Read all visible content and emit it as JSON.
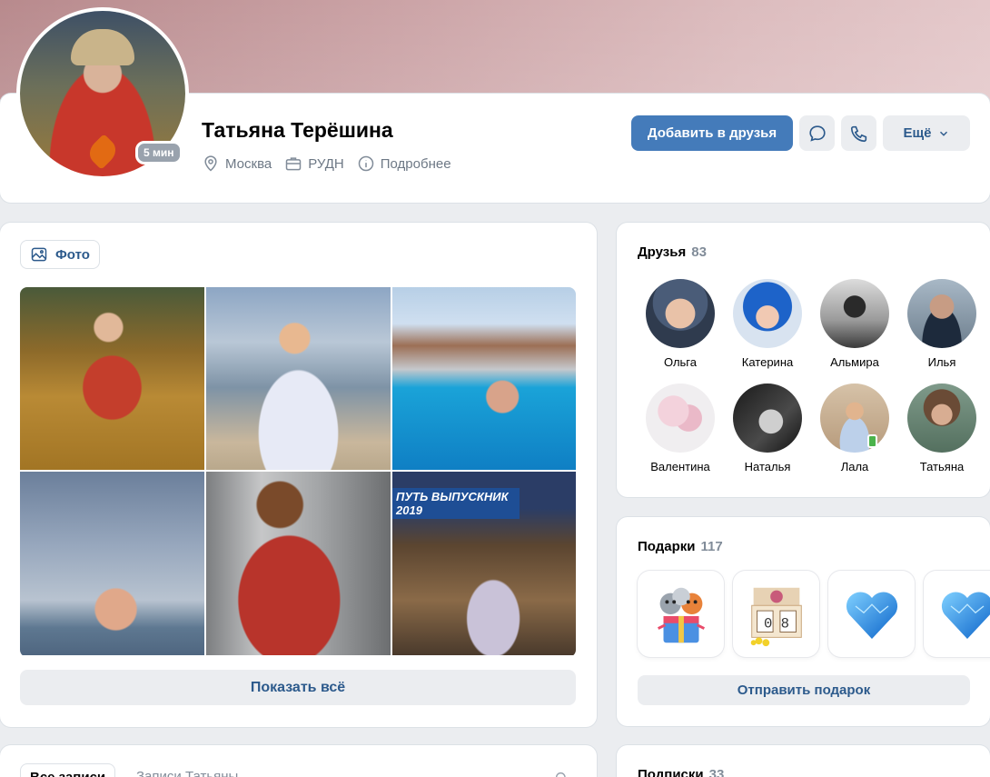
{
  "profile": {
    "name": "Татьяна Терёшина",
    "online": "5 мин",
    "city": "Москва",
    "work": "РУДН",
    "more": "Подробнее"
  },
  "actions": {
    "add_friend": "Добавить в друзья",
    "more": "Ещё"
  },
  "photos": {
    "chip_label": "Фото",
    "banner_text": "ПУТЬ ВЫПУСКНИК 2019",
    "show_all": "Показать всё"
  },
  "friends": {
    "title": "Друзья",
    "count": "83",
    "items": [
      {
        "name": "Ольга"
      },
      {
        "name": "Катерина"
      },
      {
        "name": "Альмира"
      },
      {
        "name": "Илья"
      },
      {
        "name": "Валентина"
      },
      {
        "name": "Наталья"
      },
      {
        "name": "Лала"
      },
      {
        "name": "Татьяна"
      }
    ]
  },
  "gifts": {
    "title": "Подарки",
    "count": "117",
    "calendar_digits": "0 8",
    "send": "Отправить подарок"
  },
  "posts": {
    "tab_all": "Все записи",
    "tab_user": "Записи Татьяны"
  },
  "subscriptions": {
    "title": "Подписки",
    "count": "33"
  },
  "colors": {
    "accent": "#447bba",
    "link": "#2c5a8c",
    "muted": "#818c99",
    "online": "#4bb34b"
  }
}
